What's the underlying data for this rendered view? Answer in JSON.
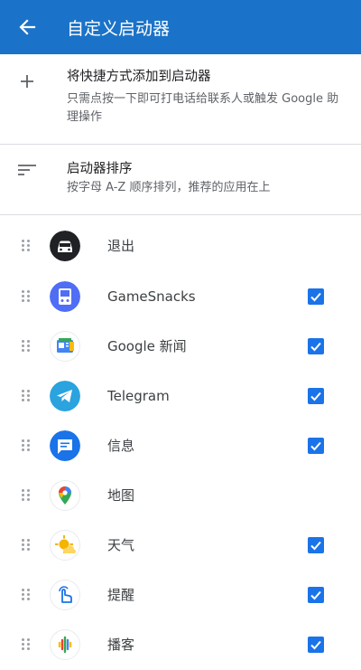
{
  "appbar": {
    "title": "自定义启动器",
    "back_icon": "arrow-back-icon"
  },
  "options": {
    "add_shortcut": {
      "icon": "plus-icon",
      "title": "将快捷方式添加到启动器",
      "subtitle": "只需点按一下即可打电话给联系人或触发 Google 助理操作"
    },
    "sort": {
      "icon": "sort-icon",
      "title": "启动器排序",
      "subtitle": "按字母 A-Z 顺序排列，推荐的应用在上"
    }
  },
  "colors": {
    "appbar": "#1a73c8",
    "checkbox": "#1a73e8",
    "divider": "#dadce0"
  },
  "apps": [
    {
      "label": "退出",
      "icon": "car-exit-icon",
      "checked": false
    },
    {
      "label": "GameSnacks",
      "icon": "gamesnacks-icon",
      "checked": true
    },
    {
      "label": "Google 新闻",
      "icon": "google-news-icon",
      "checked": true
    },
    {
      "label": "Telegram",
      "icon": "telegram-icon",
      "checked": true
    },
    {
      "label": "信息",
      "icon": "messages-icon",
      "checked": true
    },
    {
      "label": "地图",
      "icon": "maps-icon",
      "checked": false
    },
    {
      "label": "天气",
      "icon": "weather-icon",
      "checked": true
    },
    {
      "label": "提醒",
      "icon": "reminder-icon",
      "checked": true
    },
    {
      "label": "播客",
      "icon": "podcasts-icon",
      "checked": true
    }
  ]
}
